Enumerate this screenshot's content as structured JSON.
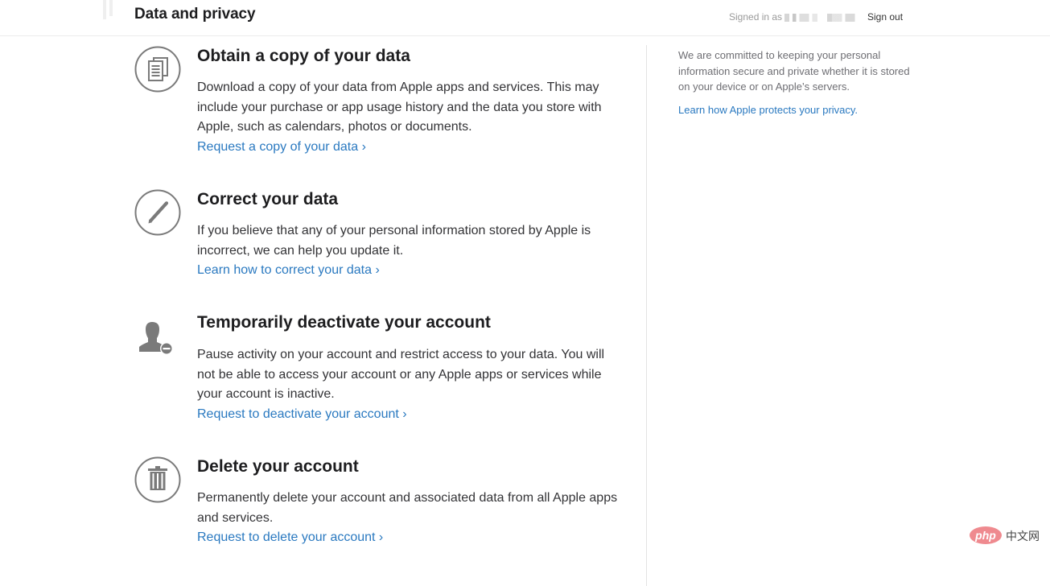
{
  "header": {
    "title": "Data and privacy",
    "signed_in_label": "Signed in as",
    "signout_label": "Sign out"
  },
  "sections": [
    {
      "icon": "documents-icon",
      "heading": "Obtain a copy of your data",
      "description": "Download a copy of your data from Apple apps and services. This may include your purchase or app usage history and the data you store with Apple, such as calendars, photos or documents.",
      "link": "Request a copy of your data ›"
    },
    {
      "icon": "pencil-icon",
      "heading": "Correct your data",
      "description": "If you believe that any of your personal information stored by Apple is incorrect, we can help you update it.",
      "link": "Learn how to correct your data ›"
    },
    {
      "icon": "user-minus-icon",
      "heading": "Temporarily deactivate your account",
      "description": "Pause activity on your account and restrict access to your data. You will not be able to access your account or any Apple apps or services while your account is inactive.",
      "link": "Request to deactivate your account ›"
    },
    {
      "icon": "trash-icon",
      "heading": "Delete your account",
      "description": "Permanently delete your account and associated data from all Apple apps and services.",
      "link": "Request to delete your account ›"
    }
  ],
  "aside": {
    "note": "We are committed to keeping your personal information secure and private whether it is stored on your device or on Apple’s servers.",
    "link": "Learn how Apple protects your privacy."
  },
  "watermark": {
    "logo_text": "php",
    "site_text": "中文网"
  },
  "colors": {
    "link": "#2a79c0",
    "icon_gray": "#7a7a7a",
    "heading": "#1d1d1f"
  }
}
